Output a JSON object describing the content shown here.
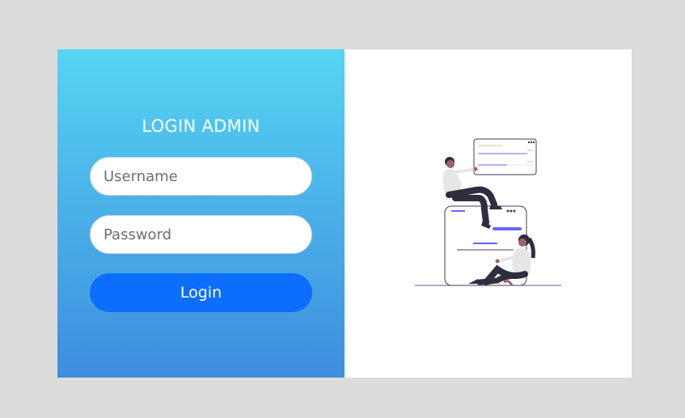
{
  "login": {
    "title": "LOGIN ADMIN",
    "username_placeholder": "Username",
    "password_placeholder": "Password",
    "submit_label": "Login"
  },
  "colors": {
    "background": "#dcdcdc",
    "panel_gradient_top": "#56d5f2",
    "panel_gradient_bottom": "#3d8ede",
    "button": "#0d6efd",
    "illustration_accent": "#6c63ff"
  },
  "illustration": {
    "icon": "people-with-web-windows-illustration"
  }
}
